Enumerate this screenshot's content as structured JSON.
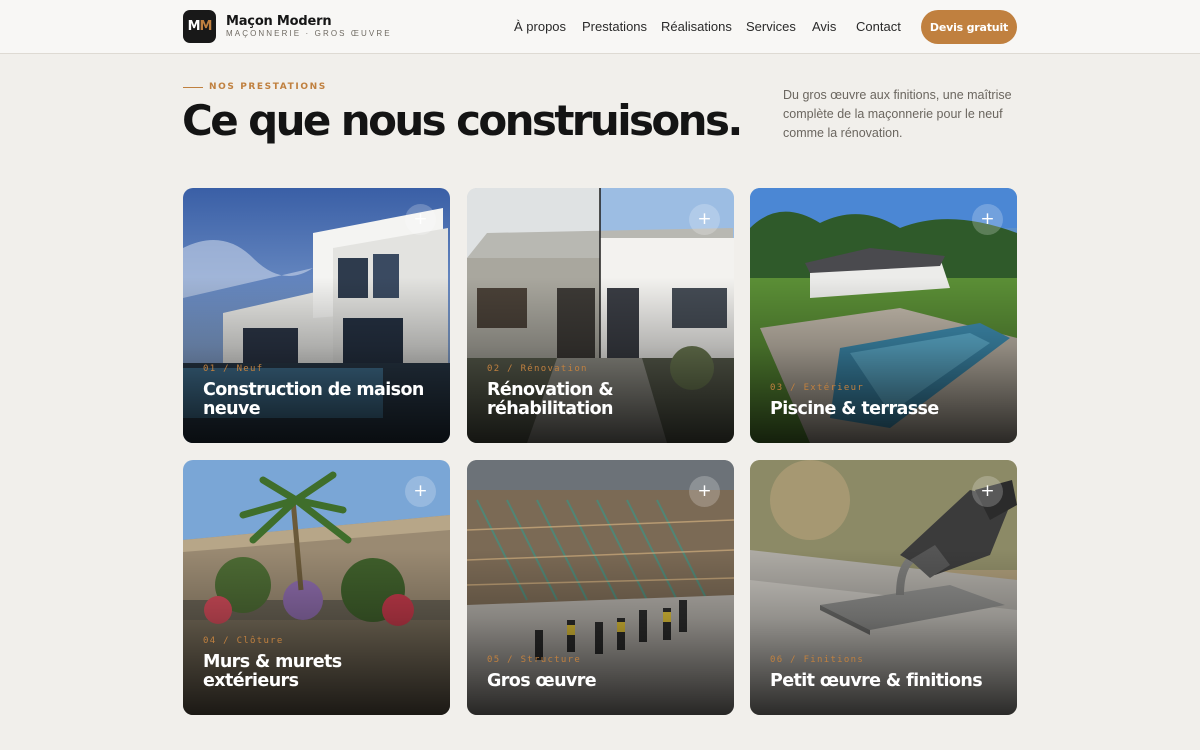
{
  "brand": {
    "mark_left": "M",
    "mark_right": "M",
    "name": "Maçon Modern",
    "tagline": "MAÇONNERIE · GROS ŒUVRE"
  },
  "nav": {
    "items": [
      {
        "label": "À propos"
      },
      {
        "label": "Prestations"
      },
      {
        "label": "Réalisations"
      },
      {
        "label": "Services"
      },
      {
        "label": "Avis"
      },
      {
        "label": "Contact"
      }
    ],
    "cta_label": "Devis gratuit"
  },
  "section": {
    "eyebrow": "NOS PRESTATIONS",
    "title": "Ce que nous construisons.",
    "lead": "Du gros œuvre aux finitions, une maîtrise complète de la maçonnerie pour le neuf comme la rénovation."
  },
  "cards": [
    {
      "tag": "01 / Neuf",
      "title": "Construction de maison neuve",
      "icon": "plus-icon"
    },
    {
      "tag": "02 / Rénovation",
      "title": "Rénovation & réhabilitation",
      "icon": "plus-icon"
    },
    {
      "tag": "03 / Extérieur",
      "title": "Piscine & terrasse",
      "icon": "plus-icon"
    },
    {
      "tag": "04 / Clôture",
      "title": "Murs & murets extérieurs",
      "icon": "plus-icon"
    },
    {
      "tag": "05 / Structure",
      "title": "Gros œuvre",
      "icon": "plus-icon"
    },
    {
      "tag": "06 / Finitions",
      "title": "Petit œuvre & finitions",
      "icon": "plus-icon"
    }
  ],
  "plus_glyph": "+",
  "colors": {
    "accent": "#c0803f",
    "background": "#f1efeb",
    "text": "#141414",
    "muted": "#6b665f"
  }
}
